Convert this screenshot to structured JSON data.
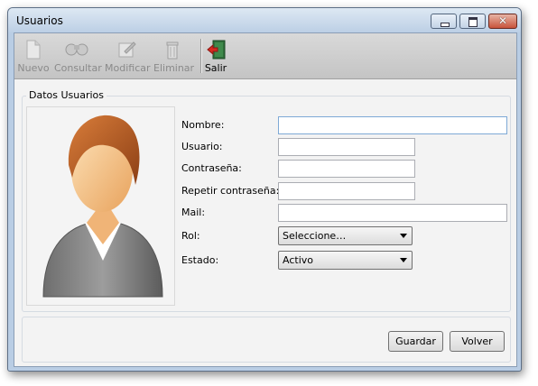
{
  "window": {
    "title": "Usuarios",
    "controls": {
      "minimize_icon": "minimize-icon",
      "maximize_icon": "maximize-icon",
      "close_icon": "close-icon"
    }
  },
  "toolbar": {
    "nuevo": "Nuevo",
    "consultar": "Consultar",
    "modificar": "Modificar",
    "eliminar": "Eliminar",
    "salir": "Salir"
  },
  "form": {
    "group_title": "Datos Usuarios",
    "avatar_icon": "user-avatar-icon",
    "nombre": {
      "label": "Nombre:",
      "value": ""
    },
    "usuario": {
      "label": "Usuario:",
      "value": ""
    },
    "contrasena": {
      "label": "Contraseña:",
      "value": ""
    },
    "repetir": {
      "label": "Repetir contraseña:",
      "value": ""
    },
    "mail": {
      "label": "Mail:",
      "value": ""
    },
    "rol": {
      "label": "Rol:",
      "selected": "Seleccione…"
    },
    "estado": {
      "label": "Estado:",
      "selected": "Activo"
    }
  },
  "actions": {
    "guardar": "Guardar",
    "volver": "Volver"
  },
  "colors": {
    "titlebar": "#c7d7ea",
    "toolbar": "#d0d0d0",
    "close_button": "#c8533b",
    "focus_border": "#7ea9d6"
  }
}
